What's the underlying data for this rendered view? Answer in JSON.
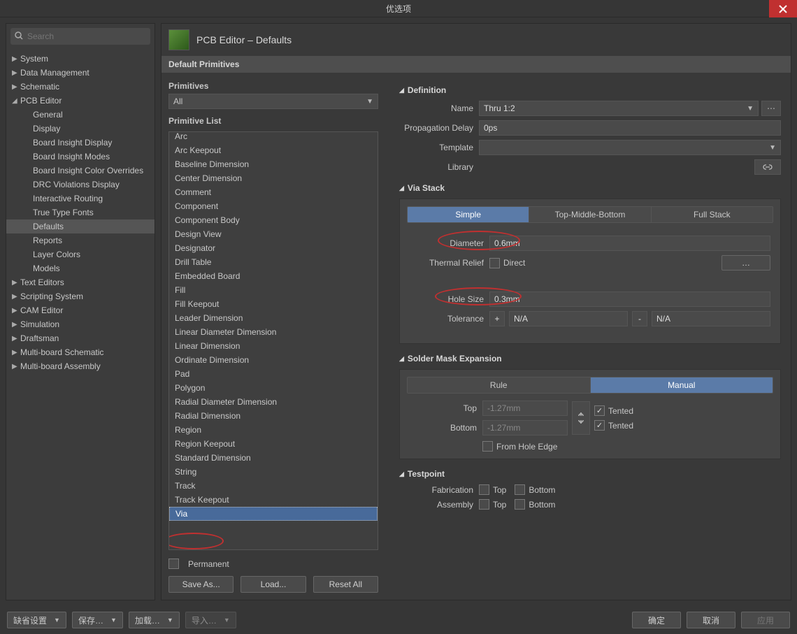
{
  "window": {
    "title": "优选项"
  },
  "search": {
    "placeholder": "Search"
  },
  "sidebar": {
    "items": [
      {
        "label": "System",
        "type": "parent",
        "arrow": "▶"
      },
      {
        "label": "Data Management",
        "type": "parent",
        "arrow": "▶"
      },
      {
        "label": "Schematic",
        "type": "parent",
        "arrow": "▶"
      },
      {
        "label": "PCB Editor",
        "type": "parent",
        "arrow": "◢"
      },
      {
        "label": "General",
        "type": "child"
      },
      {
        "label": "Display",
        "type": "child"
      },
      {
        "label": "Board Insight Display",
        "type": "child"
      },
      {
        "label": "Board Insight Modes",
        "type": "child"
      },
      {
        "label": "Board Insight Color Overrides",
        "type": "child"
      },
      {
        "label": "DRC Violations Display",
        "type": "child"
      },
      {
        "label": "Interactive Routing",
        "type": "child"
      },
      {
        "label": "True Type Fonts",
        "type": "child"
      },
      {
        "label": "Defaults",
        "type": "child",
        "selected": true
      },
      {
        "label": "Reports",
        "type": "child"
      },
      {
        "label": "Layer Colors",
        "type": "child"
      },
      {
        "label": "Models",
        "type": "child"
      },
      {
        "label": "Text Editors",
        "type": "parent",
        "arrow": "▶"
      },
      {
        "label": "Scripting System",
        "type": "parent",
        "arrow": "▶"
      },
      {
        "label": "CAM Editor",
        "type": "parent",
        "arrow": "▶"
      },
      {
        "label": "Simulation",
        "type": "parent",
        "arrow": "▶"
      },
      {
        "label": "Draftsman",
        "type": "parent",
        "arrow": "▶"
      },
      {
        "label": "Multi-board Schematic",
        "type": "parent",
        "arrow": "▶"
      },
      {
        "label": "Multi-board Assembly",
        "type": "parent",
        "arrow": "▶"
      }
    ]
  },
  "page": {
    "title": "PCB Editor – Defaults",
    "section": "Default Primitives"
  },
  "primitives": {
    "label": "Primitives",
    "filter": "All",
    "list_label": "Primitive List",
    "items": [
      "Arc",
      "Arc Keepout",
      "Baseline Dimension",
      "Center Dimension",
      "Comment",
      "Component",
      "Component Body",
      "Design View",
      "Designator",
      "Drill Table",
      "Embedded Board",
      "Fill",
      "Fill Keepout",
      "Leader Dimension",
      "Linear Diameter Dimension",
      "Linear Dimension",
      "Ordinate Dimension",
      "Pad",
      "Polygon",
      "Radial Diameter Dimension",
      "Radial Dimension",
      "Region",
      "Region Keepout",
      "Standard Dimension",
      "String",
      "Track",
      "Track Keepout",
      "Via"
    ],
    "selected": "Via",
    "permanent_label": "Permanent",
    "buttons": {
      "save": "Save As...",
      "load": "Load...",
      "reset": "Reset All"
    }
  },
  "definition": {
    "head": "Definition",
    "name_label": "Name",
    "name_value": "Thru 1:2",
    "prop_label": "Propagation Delay",
    "prop_value": "0ps",
    "tmpl_label": "Template",
    "tmpl_value": "",
    "lib_label": "Library"
  },
  "via_stack": {
    "head": "Via Stack",
    "tabs": [
      "Simple",
      "Top-Middle-Bottom",
      "Full Stack"
    ],
    "active": 0,
    "diameter_label": "Diameter",
    "diameter_value": "0.6mm",
    "thermal_label": "Thermal Relief",
    "direct_label": "Direct",
    "more": "…",
    "hole_label": "Hole Size",
    "hole_value": "0.3mm",
    "tol_label": "Tolerance",
    "tol_plus": "+",
    "tol_minus": "-",
    "tol_na": "N/A"
  },
  "solder": {
    "head": "Solder Mask Expansion",
    "tabs": [
      "Rule",
      "Manual"
    ],
    "active": 1,
    "top_label": "Top",
    "top_value": "-1.27mm",
    "bottom_label": "Bottom",
    "bottom_value": "-1.27mm",
    "tented": "Tented",
    "from_hole": "From Hole Edge"
  },
  "testpoint": {
    "head": "Testpoint",
    "fab_label": "Fabrication",
    "asm_label": "Assembly",
    "top": "Top",
    "bottom": "Bottom"
  },
  "footer": {
    "defaults": "缺省设置",
    "save": "保存…",
    "load": "加载…",
    "import": "导入…",
    "ok": "确定",
    "cancel": "取消",
    "apply": "应用"
  }
}
